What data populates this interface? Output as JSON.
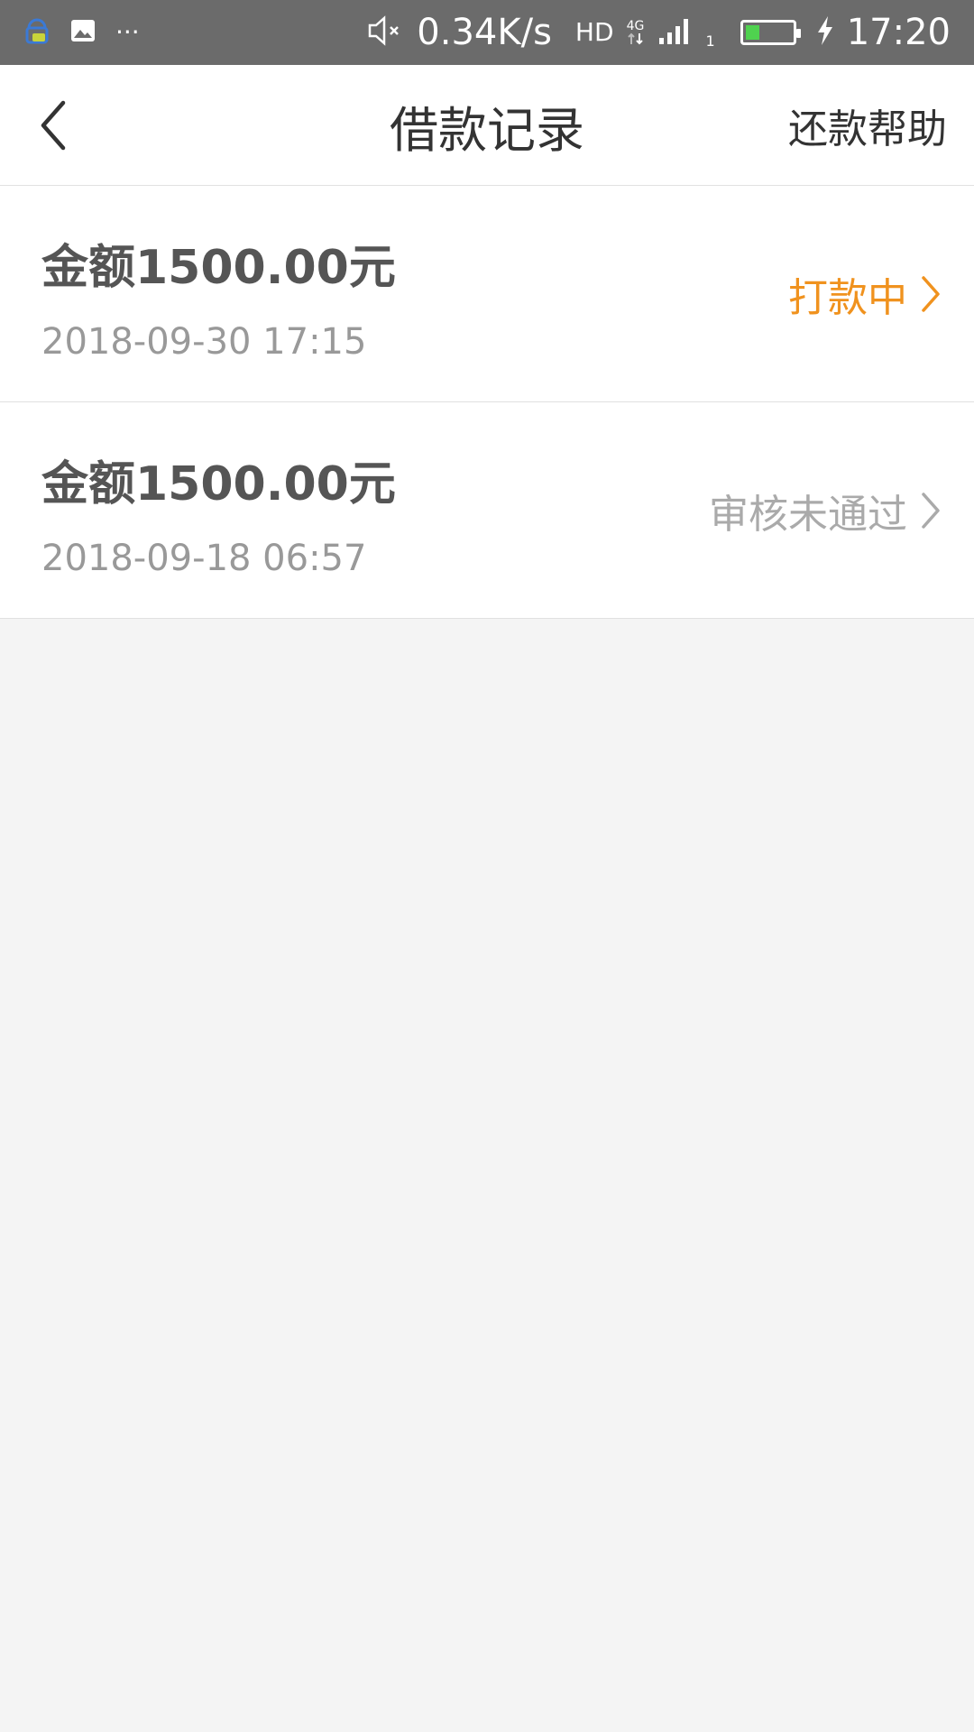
{
  "status_bar": {
    "network_speed": "0.34K/s",
    "hd_label": "HD",
    "net_type": "4G",
    "sim_slot": "1",
    "time": "17:20",
    "overflow": "···",
    "battery_level": 0.3
  },
  "nav": {
    "title": "借款记录",
    "help_label": "还款帮助"
  },
  "records": [
    {
      "amount": "金额1500.00元",
      "date": "2018-09-30 17:15",
      "status": "打款中",
      "status_color": "#f0921e"
    },
    {
      "amount": "金额1500.00元",
      "date": "2018-09-18 06:57",
      "status": "审核未通过",
      "status_color": "#aaaaaa"
    }
  ],
  "colors": {
    "accent_orange": "#f0921e",
    "status_gray": "#aaaaaa",
    "background": "#f4f4f4",
    "status_bar": "#6b6b6b"
  }
}
